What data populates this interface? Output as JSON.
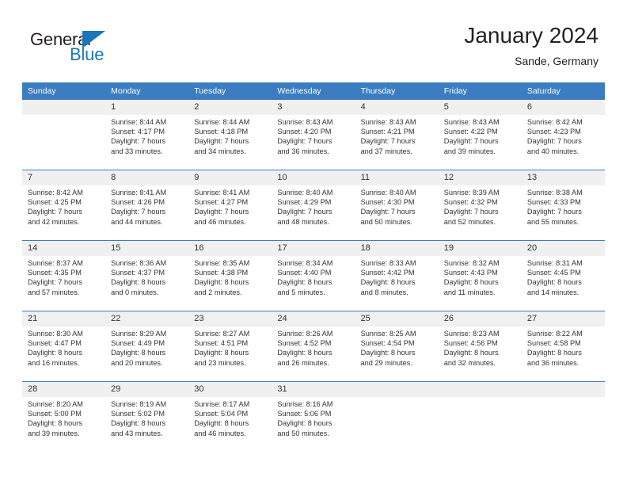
{
  "brand": {
    "name_part1": "General",
    "name_part2": "Blue",
    "flag_icon": "triangle-flag-icon"
  },
  "header": {
    "month_title": "January 2024",
    "location": "Sande, Germany"
  },
  "colors": {
    "header_blue": "#3b7dc0",
    "brand_blue": "#1b75bb",
    "daynum_band": "#f0f0f0",
    "text": "#333333"
  },
  "calendar": {
    "weekday_headers": [
      "Sunday",
      "Monday",
      "Tuesday",
      "Wednesday",
      "Thursday",
      "Friday",
      "Saturday"
    ],
    "weeks": [
      {
        "days": [
          {
            "num": "",
            "sunrise": "",
            "sunset": "",
            "daylight_line1": "",
            "daylight_line2": ""
          },
          {
            "num": "1",
            "sunrise": "Sunrise: 8:44 AM",
            "sunset": "Sunset: 4:17 PM",
            "daylight_line1": "Daylight: 7 hours",
            "daylight_line2": "and 33 minutes."
          },
          {
            "num": "2",
            "sunrise": "Sunrise: 8:44 AM",
            "sunset": "Sunset: 4:18 PM",
            "daylight_line1": "Daylight: 7 hours",
            "daylight_line2": "and 34 minutes."
          },
          {
            "num": "3",
            "sunrise": "Sunrise: 8:43 AM",
            "sunset": "Sunset: 4:20 PM",
            "daylight_line1": "Daylight: 7 hours",
            "daylight_line2": "and 36 minutes."
          },
          {
            "num": "4",
            "sunrise": "Sunrise: 8:43 AM",
            "sunset": "Sunset: 4:21 PM",
            "daylight_line1": "Daylight: 7 hours",
            "daylight_line2": "and 37 minutes."
          },
          {
            "num": "5",
            "sunrise": "Sunrise: 8:43 AM",
            "sunset": "Sunset: 4:22 PM",
            "daylight_line1": "Daylight: 7 hours",
            "daylight_line2": "and 39 minutes."
          },
          {
            "num": "6",
            "sunrise": "Sunrise: 8:42 AM",
            "sunset": "Sunset: 4:23 PM",
            "daylight_line1": "Daylight: 7 hours",
            "daylight_line2": "and 40 minutes."
          }
        ]
      },
      {
        "days": [
          {
            "num": "7",
            "sunrise": "Sunrise: 8:42 AM",
            "sunset": "Sunset: 4:25 PM",
            "daylight_line1": "Daylight: 7 hours",
            "daylight_line2": "and 42 minutes."
          },
          {
            "num": "8",
            "sunrise": "Sunrise: 8:41 AM",
            "sunset": "Sunset: 4:26 PM",
            "daylight_line1": "Daylight: 7 hours",
            "daylight_line2": "and 44 minutes."
          },
          {
            "num": "9",
            "sunrise": "Sunrise: 8:41 AM",
            "sunset": "Sunset: 4:27 PM",
            "daylight_line1": "Daylight: 7 hours",
            "daylight_line2": "and 46 minutes."
          },
          {
            "num": "10",
            "sunrise": "Sunrise: 8:40 AM",
            "sunset": "Sunset: 4:29 PM",
            "daylight_line1": "Daylight: 7 hours",
            "daylight_line2": "and 48 minutes."
          },
          {
            "num": "11",
            "sunrise": "Sunrise: 8:40 AM",
            "sunset": "Sunset: 4:30 PM",
            "daylight_line1": "Daylight: 7 hours",
            "daylight_line2": "and 50 minutes."
          },
          {
            "num": "12",
            "sunrise": "Sunrise: 8:39 AM",
            "sunset": "Sunset: 4:32 PM",
            "daylight_line1": "Daylight: 7 hours",
            "daylight_line2": "and 52 minutes."
          },
          {
            "num": "13",
            "sunrise": "Sunrise: 8:38 AM",
            "sunset": "Sunset: 4:33 PM",
            "daylight_line1": "Daylight: 7 hours",
            "daylight_line2": "and 55 minutes."
          }
        ]
      },
      {
        "days": [
          {
            "num": "14",
            "sunrise": "Sunrise: 8:37 AM",
            "sunset": "Sunset: 4:35 PM",
            "daylight_line1": "Daylight: 7 hours",
            "daylight_line2": "and 57 minutes."
          },
          {
            "num": "15",
            "sunrise": "Sunrise: 8:36 AM",
            "sunset": "Sunset: 4:37 PM",
            "daylight_line1": "Daylight: 8 hours",
            "daylight_line2": "and 0 minutes."
          },
          {
            "num": "16",
            "sunrise": "Sunrise: 8:35 AM",
            "sunset": "Sunset: 4:38 PM",
            "daylight_line1": "Daylight: 8 hours",
            "daylight_line2": "and 2 minutes."
          },
          {
            "num": "17",
            "sunrise": "Sunrise: 8:34 AM",
            "sunset": "Sunset: 4:40 PM",
            "daylight_line1": "Daylight: 8 hours",
            "daylight_line2": "and 5 minutes."
          },
          {
            "num": "18",
            "sunrise": "Sunrise: 8:33 AM",
            "sunset": "Sunset: 4:42 PM",
            "daylight_line1": "Daylight: 8 hours",
            "daylight_line2": "and 8 minutes."
          },
          {
            "num": "19",
            "sunrise": "Sunrise: 8:32 AM",
            "sunset": "Sunset: 4:43 PM",
            "daylight_line1": "Daylight: 8 hours",
            "daylight_line2": "and 11 minutes."
          },
          {
            "num": "20",
            "sunrise": "Sunrise: 8:31 AM",
            "sunset": "Sunset: 4:45 PM",
            "daylight_line1": "Daylight: 8 hours",
            "daylight_line2": "and 14 minutes."
          }
        ]
      },
      {
        "days": [
          {
            "num": "21",
            "sunrise": "Sunrise: 8:30 AM",
            "sunset": "Sunset: 4:47 PM",
            "daylight_line1": "Daylight: 8 hours",
            "daylight_line2": "and 16 minutes."
          },
          {
            "num": "22",
            "sunrise": "Sunrise: 8:29 AM",
            "sunset": "Sunset: 4:49 PM",
            "daylight_line1": "Daylight: 8 hours",
            "daylight_line2": "and 20 minutes."
          },
          {
            "num": "23",
            "sunrise": "Sunrise: 8:27 AM",
            "sunset": "Sunset: 4:51 PM",
            "daylight_line1": "Daylight: 8 hours",
            "daylight_line2": "and 23 minutes."
          },
          {
            "num": "24",
            "sunrise": "Sunrise: 8:26 AM",
            "sunset": "Sunset: 4:52 PM",
            "daylight_line1": "Daylight: 8 hours",
            "daylight_line2": "and 26 minutes."
          },
          {
            "num": "25",
            "sunrise": "Sunrise: 8:25 AM",
            "sunset": "Sunset: 4:54 PM",
            "daylight_line1": "Daylight: 8 hours",
            "daylight_line2": "and 29 minutes."
          },
          {
            "num": "26",
            "sunrise": "Sunrise: 8:23 AM",
            "sunset": "Sunset: 4:56 PM",
            "daylight_line1": "Daylight: 8 hours",
            "daylight_line2": "and 32 minutes."
          },
          {
            "num": "27",
            "sunrise": "Sunrise: 8:22 AM",
            "sunset": "Sunset: 4:58 PM",
            "daylight_line1": "Daylight: 8 hours",
            "daylight_line2": "and 36 minutes."
          }
        ]
      },
      {
        "days": [
          {
            "num": "28",
            "sunrise": "Sunrise: 8:20 AM",
            "sunset": "Sunset: 5:00 PM",
            "daylight_line1": "Daylight: 8 hours",
            "daylight_line2": "and 39 minutes."
          },
          {
            "num": "29",
            "sunrise": "Sunrise: 8:19 AM",
            "sunset": "Sunset: 5:02 PM",
            "daylight_line1": "Daylight: 8 hours",
            "daylight_line2": "and 43 minutes."
          },
          {
            "num": "30",
            "sunrise": "Sunrise: 8:17 AM",
            "sunset": "Sunset: 5:04 PM",
            "daylight_line1": "Daylight: 8 hours",
            "daylight_line2": "and 46 minutes."
          },
          {
            "num": "31",
            "sunrise": "Sunrise: 8:16 AM",
            "sunset": "Sunset: 5:06 PM",
            "daylight_line1": "Daylight: 8 hours",
            "daylight_line2": "and 50 minutes."
          },
          {
            "num": "",
            "sunrise": "",
            "sunset": "",
            "daylight_line1": "",
            "daylight_line2": ""
          },
          {
            "num": "",
            "sunrise": "",
            "sunset": "",
            "daylight_line1": "",
            "daylight_line2": ""
          },
          {
            "num": "",
            "sunrise": "",
            "sunset": "",
            "daylight_line1": "",
            "daylight_line2": ""
          }
        ]
      }
    ]
  }
}
